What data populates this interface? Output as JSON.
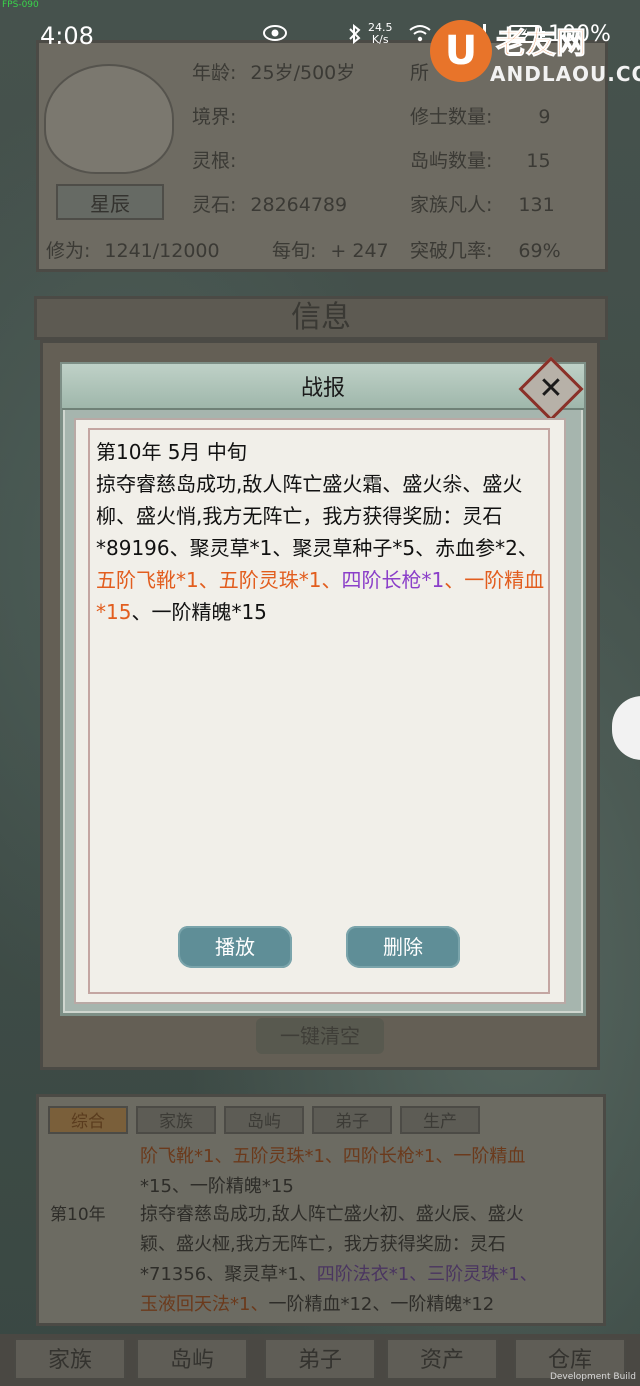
{
  "status_bar": {
    "fps": "FPS-090",
    "time": "4:08",
    "net_speed_value": "24.5",
    "net_speed_unit": "K/s",
    "battery": "100%"
  },
  "watermark": {
    "logo": "U",
    "title": "老友网",
    "sub": "ANDLAOU.COM"
  },
  "player": {
    "name": "星辰",
    "stats": [
      {
        "label": "年龄:",
        "value": "25岁/500岁"
      },
      {
        "label": "境界:",
        "value": "",
        "red": true
      },
      {
        "label": "灵根:",
        "value": "",
        "red": true
      },
      {
        "label": "灵石:",
        "value": "28264789"
      }
    ],
    "cultivation_label": "修为:",
    "cultivation_value": "1241/12000",
    "per_period_label": "每旬:",
    "per_period_value": "+ 247",
    "right_stats": [
      {
        "label": "所",
        "value": ""
      },
      {
        "label": "修士数量:",
        "value": "9"
      },
      {
        "label": "岛屿数量:",
        "value": "15"
      },
      {
        "label": "家族凡人:",
        "value": "131"
      },
      {
        "label": "突破几率:",
        "value": "69%"
      }
    ]
  },
  "info_panel": {
    "title": "信息",
    "clear_button": "一键清空"
  },
  "dialog": {
    "title": "战报",
    "date": "第10年 5月 中旬",
    "body_plain": "掠夺睿慈岛成功,敌人阵亡盛火霜、盛火尜、盛火柳、盛火悄,我方无阵亡，我方获得奖励：灵石*89196、聚灵草*1、聚灵草种子*5、赤血参*2、",
    "reward_orange_1": "五阶飞靴*1、五阶灵珠*1、",
    "reward_purple": "四阶长枪*1",
    "reward_sep": "、",
    "reward_orange_2": "一阶精血*15",
    "reward_tail": "、一阶精魄*15",
    "play_button": "播放",
    "delete_button": "删除"
  },
  "log_panel": {
    "tabs": [
      "综合",
      "家族",
      "岛屿",
      "弟子",
      "生产"
    ],
    "active_tab": "综合",
    "line1_a": "阶飞靴*1、五阶灵珠*1、四阶长枪*1、",
    "line1_b": "一阶精血",
    "line2": "*15、一阶精魄*15",
    "date": "第10年",
    "line3": "掠夺睿慈岛成功,敌人阵亡盛火初、盛火辰、盛火",
    "line4": "颖、盛火桠,我方无阵亡，我方获得奖励：灵石",
    "line5_a": "*71356、聚灵草*1、",
    "line5_b": "四阶法衣*1、三阶灵珠*1、",
    "line6_a": "玉液回天法*1、",
    "line6_b": "一阶精血*12、一阶精魄*12"
  },
  "bottom_nav": [
    "家族",
    "岛屿",
    "弟子",
    "资产",
    "仓库"
  ],
  "footer": "Development Build"
}
